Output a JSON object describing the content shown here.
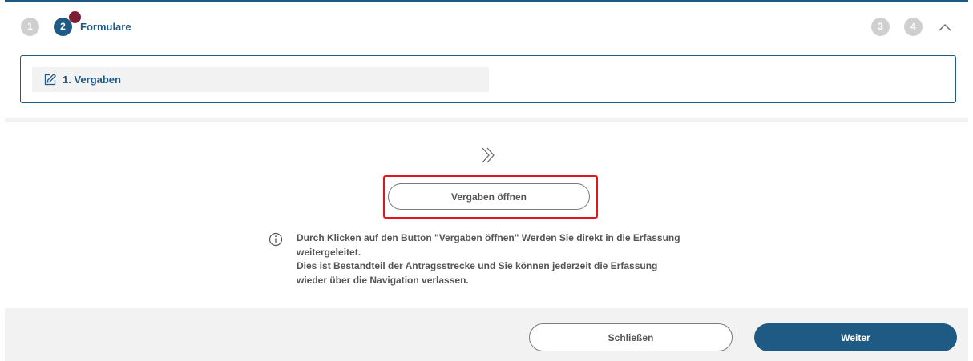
{
  "stepper": {
    "steps": [
      {
        "number": "1",
        "state": "inactive"
      },
      {
        "number": "2",
        "state": "active"
      },
      {
        "number": "3",
        "state": "inactive"
      },
      {
        "number": "4",
        "state": "inactive"
      }
    ],
    "active_label": "Formulare",
    "collapse_icon": "chevron-up-icon"
  },
  "forms": {
    "items": [
      {
        "label": "1. Vergaben",
        "icon": "edit-icon"
      }
    ]
  },
  "main": {
    "chevron_icon": "double-chevron-right-icon",
    "open_button_label": "Vergaben öffnen",
    "info_icon": "info-icon",
    "info_lines": [
      "Durch Klicken auf den Button \"Vergaben öffnen\" Werden Sie direkt in die Erfassung weitergeleitet.",
      "Dies ist Bestandteil der Antragsstrecke und Sie können jederzeit die Erfassung wieder über die Navigation verlassen."
    ]
  },
  "footer": {
    "close_label": "Schließen",
    "next_label": "Weiter"
  },
  "colors": {
    "primary": "#1e5a84",
    "badge": "#7a1f34",
    "highlight": "#e3141b",
    "inactive_step": "#cfcfcf"
  }
}
